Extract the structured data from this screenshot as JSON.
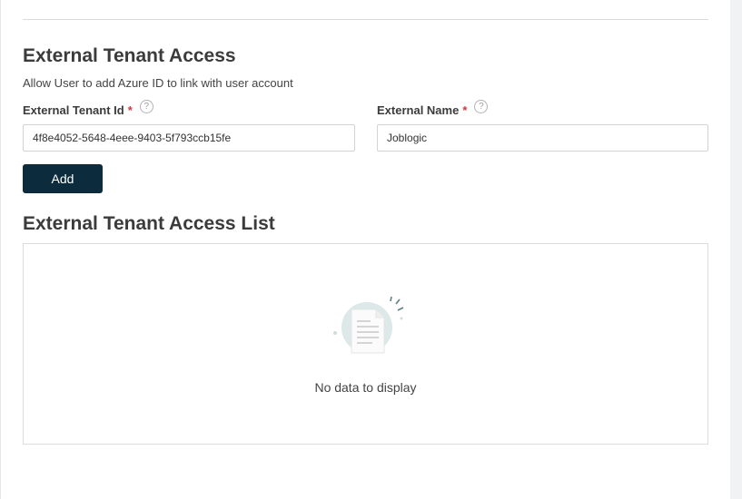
{
  "section": {
    "title": "External Tenant Access",
    "description": "Allow User to add Azure ID to link with user account"
  },
  "form": {
    "tenant_id": {
      "label": "External Tenant Id",
      "required_mark": "*",
      "help": "?",
      "value": "4f8e4052-5648-4eee-9403-5f793ccb15fe"
    },
    "external_name": {
      "label": "External Name",
      "required_mark": "*",
      "help": "?",
      "value": "Joblogic"
    },
    "add_label": "Add"
  },
  "list": {
    "title": "External Tenant Access List",
    "empty_text": "No data to display",
    "empty_icon": "empty-document-icon"
  },
  "colors": {
    "button_bg": "#0c2c3d",
    "required": "#d9333f"
  }
}
